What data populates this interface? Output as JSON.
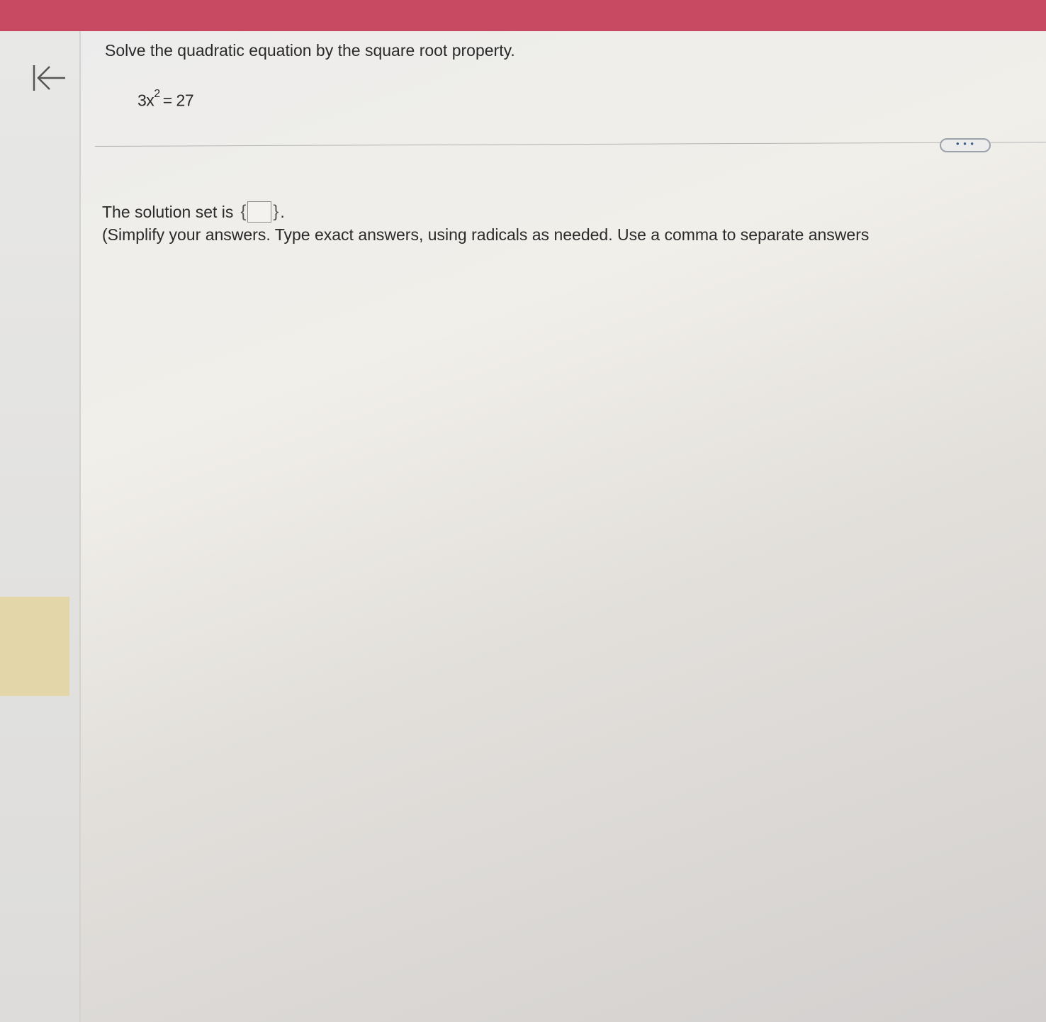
{
  "question": {
    "prompt": "Solve the quadratic equation by the square root property.",
    "equation": {
      "lhs_coefficient_var": "3x",
      "exponent": "2",
      "rhs": "= 27"
    }
  },
  "toolbar": {
    "more_label": "• • •"
  },
  "answer": {
    "lead_text": "The solution set is",
    "open_brace": "{",
    "close_brace": "}",
    "trailing": ".",
    "value": "",
    "instruction": "(Simplify your answers. Type exact answers, using radicals as needed. Use a comma to separate answers"
  },
  "colors": {
    "topbar": "#c84a62",
    "sidebar_highlight": "#e3d7aa",
    "more_button_border": "#9ba2ab"
  },
  "icons": {
    "back": "arrow-left-to-bar-icon"
  }
}
